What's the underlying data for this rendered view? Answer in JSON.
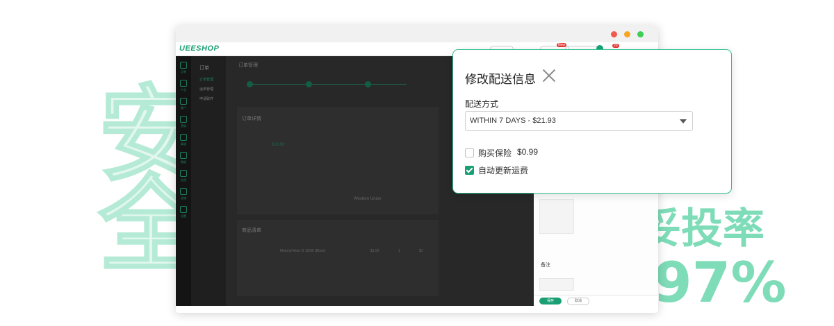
{
  "decor": {
    "char_an": "安",
    "char_quan": "全",
    "rate_text": "妥投率",
    "rate_value": "97%"
  },
  "window": {
    "controls": [
      "close",
      "minimize",
      "maximize"
    ]
  },
  "app": {
    "logo": "UEESHOP",
    "header_badge_new": "New",
    "header_badge_count": "20"
  },
  "sidebar": {
    "items": [
      {
        "icon": "clipboard-icon",
        "label": "订单"
      },
      {
        "icon": "box-icon",
        "label": "产品"
      },
      {
        "icon": "user-icon",
        "label": "客户"
      },
      {
        "icon": "mail-icon",
        "label": "营销"
      },
      {
        "icon": "triangle-icon",
        "label": "渠道"
      },
      {
        "icon": "bar-chart-icon",
        "label": "数据"
      },
      {
        "icon": "apps-icon",
        "label": "应用"
      },
      {
        "icon": "store-icon",
        "label": "店铺"
      },
      {
        "icon": "gear-icon",
        "label": "设置"
      }
    ]
  },
  "submenu": {
    "title": "订单",
    "items": [
      "订单管理",
      "运单管理",
      "申请取件"
    ]
  },
  "order": {
    "breadcrumb_title": "订单管理",
    "order_no_label": "订单详情",
    "currency_total": "$19.96",
    "payment_method": "Western Union",
    "product_section": "商品清单",
    "product_name": "Motorol Moto G 16GB (Black)",
    "price": "$1.00",
    "qty": "1",
    "total": "$1"
  },
  "right_panel": {
    "save_label": "保存",
    "cancel_label": "取消",
    "notes_label": "备注"
  },
  "modal": {
    "title": "修改配送信息",
    "shipping_label": "配送方式",
    "shipping_selected": "WITHIN 7 DAYS - $21.93",
    "insurance_label": "购买保险",
    "insurance_price": "$0.99",
    "insurance_checked": false,
    "auto_update_label": "自动更新运费",
    "auto_update_checked": true
  },
  "colors": {
    "accent": "#1a9f74",
    "modal_border": "#2cbf8c",
    "sidebar_bg": "#1f1f1f",
    "decor_text": "#7fdcb8"
  }
}
